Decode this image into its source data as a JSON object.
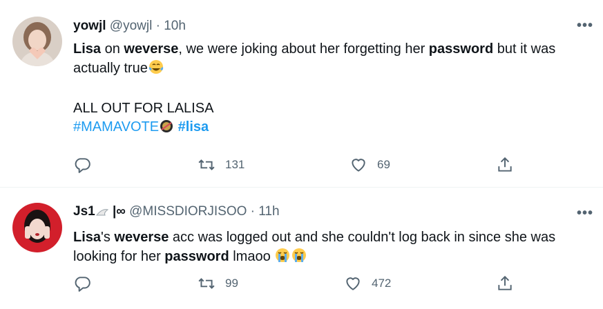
{
  "tweets": [
    {
      "name": "yowjl",
      "handle": "@yowjl",
      "sep": " · ",
      "time": "10h",
      "more_label": "•••",
      "p1": [
        {
          "t": "Lisa",
          "b": true
        },
        {
          "t": " on ",
          "b": false
        },
        {
          "t": "weverse",
          "b": true
        },
        {
          "t": ", we were joking about her forgetting her ",
          "b": false
        },
        {
          "t": "password",
          "b": true
        },
        {
          "t": " but it was actually true",
          "b": false
        }
      ],
      "p2": "ALL OUT FOR LALISA",
      "hashtag1": "#MAMAVOTE",
      "hashtag2": "#lisa",
      "stats": {
        "reply": "",
        "retweet": "131",
        "like": "69"
      }
    },
    {
      "name": "Js1",
      "name_suffix": " |∞",
      "handle": "@MISSDIORJISOO",
      "sep": " · ",
      "time": "11h",
      "more_label": "•••",
      "p1": [
        {
          "t": "Lisa",
          "b": true
        },
        {
          "t": "'s ",
          "b": false
        },
        {
          "t": "weverse",
          "b": true
        },
        {
          "t": " acc was logged out and she couldn't log back in since she was looking for her ",
          "b": false
        },
        {
          "t": "password",
          "b": true
        },
        {
          "t": " lmaoo ",
          "b": false
        }
      ],
      "stats": {
        "reply": "",
        "retweet": "99",
        "like": "472"
      }
    }
  ],
  "icons": [
    "reply-icon",
    "retweet-icon",
    "like-icon",
    "share-icon",
    "more-icon",
    "tears-of-joy-emoji",
    "crying-emoji",
    "mama-award-emoji",
    "wing-emoji"
  ]
}
